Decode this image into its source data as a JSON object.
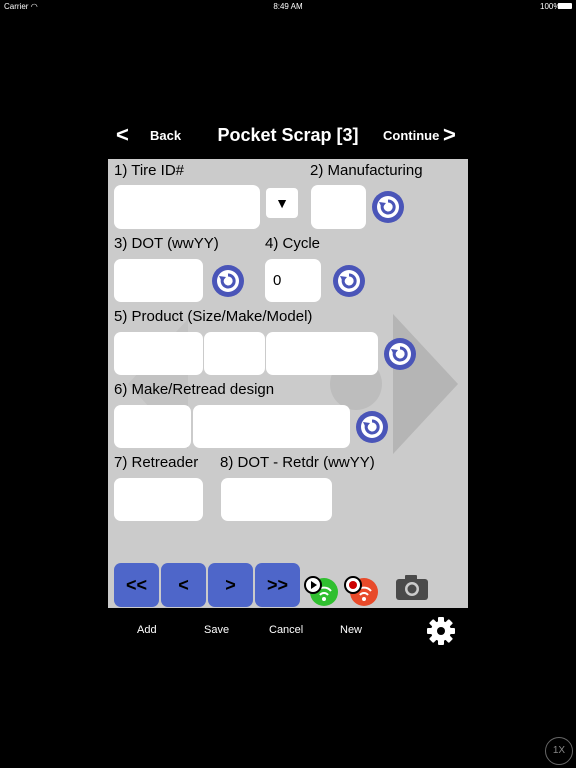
{
  "status": {
    "carrier": "Carrier",
    "time": "8:49 AM",
    "battery": "100%"
  },
  "nav": {
    "back_label": "Back",
    "title": "Pocket Scrap [3]",
    "continue_label": "Continue",
    "back_chevron": "<",
    "continue_chevron": ">"
  },
  "form": {
    "tire_id": {
      "label": "1) Tire ID#",
      "value": "",
      "dropdown_glyph": "▼"
    },
    "manufacturing": {
      "label": "2) Manufacturing",
      "value": ""
    },
    "dot": {
      "label": "3) DOT (wwYY)",
      "value": ""
    },
    "cycle": {
      "label": "4) Cycle",
      "value": "0"
    },
    "product": {
      "label": "5) Product (Size/Make/Model)",
      "size": "",
      "make": "",
      "model": ""
    },
    "make_design": {
      "label": "6) Make/Retread design",
      "make": "",
      "design": ""
    },
    "retreader": {
      "label": "7) Retreader",
      "value": ""
    },
    "dot_retdr": {
      "label": "8) DOT - Retdr (wwYY)",
      "value": ""
    }
  },
  "record_nav": {
    "first": "<<",
    "prev": "<",
    "next": ">",
    "last": ">>"
  },
  "toolbar": {
    "add": "Add",
    "save": "Save",
    "cancel": "Cancel",
    "new": "New"
  },
  "zoom_badge": "1X",
  "colors": {
    "accent_blue": "#4e66c9",
    "reset_blue": "#4a55b8",
    "panel_gray": "#cbcbcb",
    "sync_green": "#2fbf2f",
    "sync_red": "#e84a2a"
  }
}
